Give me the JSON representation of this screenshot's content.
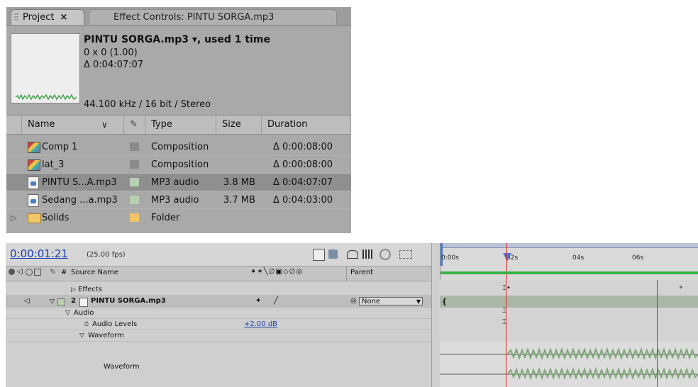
{
  "project": {
    "tab_label": "Project",
    "tab_close": "×",
    "other_tab_label": "Effect Controls: PINTU SORGA.mp3",
    "file_title": "PINTU SORGA.mp3 ▾, used 1 time",
    "file_dimensions": "0 x 0 (1.00)",
    "file_duration": "Δ 0:04:07:07",
    "file_audio": "44.100 kHz / 16 bit / Stereo",
    "columns": {
      "name": "Name",
      "type": "Type",
      "size": "Size",
      "duration": "Duration"
    },
    "items": [
      {
        "name": "Comp 1",
        "type": "Composition",
        "size": "",
        "duration": "Δ 0:00:08:00",
        "icon": "composition-icon",
        "swatch": "#8a8a8a",
        "selected": false
      },
      {
        "name": "lat_3",
        "type": "Composition",
        "size": "",
        "duration": "Δ 0:00:08:00",
        "icon": "composition-icon",
        "swatch": "#8a8a8a",
        "selected": false
      },
      {
        "name": "PINTU S...A.mp3",
        "type": "MP3 audio",
        "size": "3.8 MB",
        "duration": "Δ 0:04:07:07",
        "icon": "audio-file-icon",
        "swatch": "#b9cfb2",
        "selected": true
      },
      {
        "name": "Sedang ...a.mp3",
        "type": "MP3 audio",
        "size": "3.7 MB",
        "duration": "Δ 0:04:03:00",
        "icon": "audio-file-icon",
        "swatch": "#b9cfb2",
        "selected": false
      },
      {
        "name": "Solids",
        "type": "Folder",
        "size": "",
        "duration": "",
        "icon": "folder-icon",
        "swatch": "#f2c46a",
        "selected": false
      }
    ]
  },
  "timeline": {
    "timecode": "0:00:01:21",
    "fps": "(25.00 fps)",
    "col_hash": "#",
    "col_source": "Source Name",
    "col_parent": "Parent",
    "effects_label": "Effects",
    "layer_num": "2",
    "layer_name": "PINTU SORGA.mp3",
    "parent_value": "None",
    "audio_label": "Audio",
    "audio_levels_label": "Audio Levels",
    "audio_levels_value": "+2.00 dB",
    "waveform_group_label": "Waveform",
    "waveform_label": "Waveform",
    "ruler_labels": [
      "0:00s",
      "02s",
      "04s",
      "06s"
    ],
    "accent_blue": "#1c3fb0",
    "playhead_color": "#e02020",
    "workarea_color": "#3cb043"
  }
}
